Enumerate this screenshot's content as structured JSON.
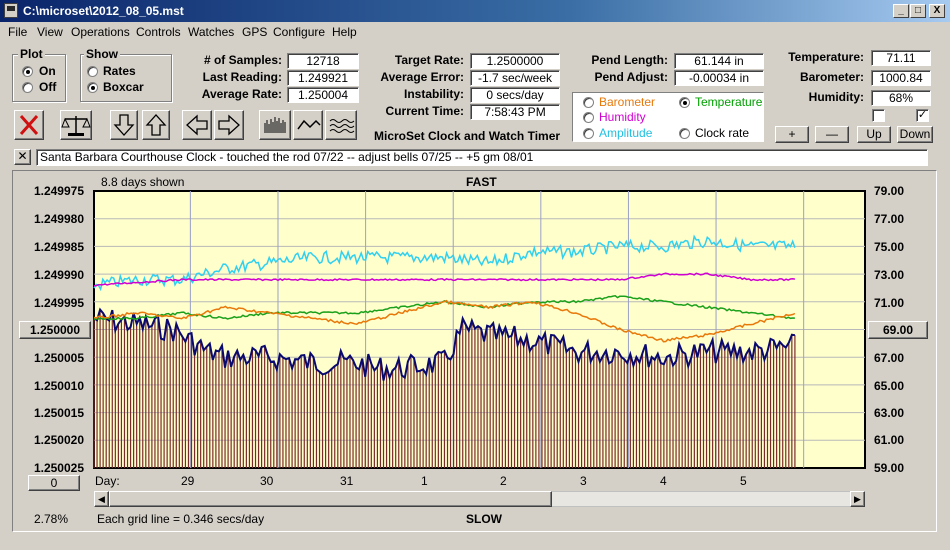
{
  "window": {
    "title": "C:\\microset\\2012_08_05.mst",
    "controls": [
      "_",
      "□",
      "X"
    ]
  },
  "menu": [
    "File",
    "View",
    "Operations",
    "Controls",
    "Watches",
    "GPS",
    "Configure",
    "Help"
  ],
  "plot_group": {
    "title": "Plot",
    "options": [
      "On",
      "Off"
    ],
    "selected": "On"
  },
  "show_group": {
    "title": "Show",
    "options": [
      "Rates",
      "Boxcar"
    ],
    "selected": "Boxcar"
  },
  "stats": {
    "samples_label": "# of Samples:",
    "samples": "12718",
    "last_label": "Last Reading:",
    "last": "1.249921",
    "avg_label": "Average Rate:",
    "avg": "1.250004",
    "target_label": "Target Rate:",
    "target": "1.2500000",
    "avgerr_label": "Average Error:",
    "avgerr": "-1.7 sec/week",
    "instab_label": "Instability:",
    "instab": "0 secs/day",
    "time_label": "Current Time:",
    "time": "7:58:43 PM",
    "pendlen_label": "Pend Length:",
    "pendlen": "61.144 in",
    "pendadj_label": "Pend Adjust:",
    "pendadj": "-0.00034 in",
    "temp_label": "Temperature:",
    "temp": "71.11",
    "baro_label": "Barometer:",
    "baro": "1000.84",
    "hum_label": "Humidity:",
    "hum": "68%"
  },
  "app_title": "MicroSet Clock and Watch Timer",
  "sensor_options": {
    "items": [
      {
        "label": "Barometer",
        "color": "#e8780a",
        "selected": false
      },
      {
        "label": "Temperature",
        "color": "#00a000",
        "selected": true
      },
      {
        "label": "Humidity",
        "color": "#d000d0",
        "selected": false
      },
      {
        "label": "Amplitude",
        "color": "#20c0e0",
        "selected": false
      },
      {
        "label": "Clock rate",
        "color": "#000000",
        "selected": false
      }
    ]
  },
  "scale_buttons": [
    "+",
    "—",
    "Up",
    "Down"
  ],
  "checkboxes": [
    false,
    true
  ],
  "toolbar_icons": [
    "close-x-icon",
    "scale-balance-icon",
    "arrow-down-icon",
    "arrow-up-icon",
    "arrow-left-icon",
    "arrow-right-icon",
    "bar-graph-icon",
    "line-graph-icon",
    "wave-graph-icon"
  ],
  "notes": "Santa Barbara Courthouse Clock  -  touched the rod 07/22  --  adjust bells 07/25  --  +5 gm 08/01",
  "graph": {
    "days_shown": "8.8 days shown",
    "top_label": "FAST",
    "bottom_label": "SLOW",
    "left_ticks": [
      "1.249975",
      "1.249980",
      "1.249985",
      "1.249990",
      "1.249995",
      "1.250000",
      "1.250005",
      "1.250010",
      "1.250015",
      "1.250020",
      "1.250025"
    ],
    "left_center_button": "1.250000",
    "left_bottom_button": "0",
    "right_ticks": [
      "79.00",
      "77.00",
      "75.00",
      "73.00",
      "71.00",
      "69.00",
      "67.00",
      "65.00",
      "63.00",
      "61.00",
      "59.00"
    ],
    "right_center_button": "69.00",
    "day_label": "Day:",
    "day_ticks": [
      "29",
      "30",
      "31",
      "1",
      "2",
      "3",
      "4",
      "5"
    ],
    "percent": "2.78%",
    "grid_note": "Each grid line = 0.346 secs/day"
  },
  "chart_data": {
    "type": "line",
    "title": "",
    "xlabel": "Day:",
    "x_ticks": [
      "29",
      "30",
      "31",
      "1",
      "2",
      "3",
      "4",
      "5"
    ],
    "y_left": {
      "label": "",
      "range": [
        1.250025,
        1.249975
      ],
      "ticks": [
        "1.249975",
        "1.249980",
        "1.249985",
        "1.249990",
        "1.249995",
        "1.250000",
        "1.250005",
        "1.250010",
        "1.250015",
        "1.250020",
        "1.250025"
      ]
    },
    "y_right": {
      "label": "",
      "range": [
        59.0,
        79.0
      ],
      "ticks": [
        "59.00",
        "61.00",
        "63.00",
        "65.00",
        "67.00",
        "69.00",
        "71.00",
        "73.00",
        "75.00",
        "77.00",
        "79.00"
      ]
    },
    "x_range_days": [
      0,
      8.8
    ],
    "day_tick_positions": [
      1.1,
      2.1,
      3.1,
      4.1,
      5.1,
      6.1,
      7.1,
      8.1
    ],
    "series": [
      {
        "name": "Clock rate",
        "color": "#0a0a6e",
        "axis": "left",
        "x": [
          0,
          0.5,
          0.9,
          1.3,
          1.5,
          2.0,
          2.5,
          3.0,
          3.2,
          3.5,
          4.0,
          4.2,
          4.5,
          5.0,
          5.5,
          6.0,
          6.5,
          7.0,
          7.5,
          8.0,
          8.8
        ],
        "y": [
          1.249998,
          1.249999,
          1.25,
          1.250004,
          1.250005,
          1.250005,
          1.250006,
          1.250006,
          1.250007,
          1.250007,
          1.250006,
          1.25,
          1.250001,
          1.250002,
          1.250004,
          1.250004,
          1.250005,
          1.250004,
          1.250004,
          1.250003,
          1.250002
        ]
      },
      {
        "name": "Amplitude",
        "color": "#30d0f0",
        "axis": "left",
        "x": [
          0,
          0.5,
          1.0,
          1.5,
          2.0,
          2.5,
          3.0,
          3.5,
          4.0,
          4.5,
          5.0,
          5.5,
          6.0,
          6.5,
          7.0,
          7.5,
          8.0,
          8.8
        ],
        "y": [
          1.249992,
          1.249991,
          1.249991,
          1.249989,
          1.249988,
          1.249987,
          1.249987,
          1.249987,
          1.249987,
          1.249988,
          1.249986,
          1.249986,
          1.249985,
          1.249985,
          1.249984,
          1.249985,
          1.249985,
          1.249985
        ]
      },
      {
        "name": "Humidity",
        "color": "#d000d0",
        "axis": "left",
        "x": [
          0,
          1.0,
          2.0,
          3.0,
          4.0,
          5.0,
          6.0,
          6.5,
          7.0,
          7.5,
          8.0,
          8.8
        ],
        "y": [
          1.249992,
          1.249991,
          1.249991,
          1.249991,
          1.249991,
          1.249991,
          1.249991,
          1.24999,
          1.24999,
          1.249991,
          1.249991,
          1.24999
        ]
      },
      {
        "name": "Temperature",
        "color": "#1aa01a",
        "axis": "left",
        "x": [
          0,
          0.5,
          1.0,
          1.5,
          2.0,
          2.5,
          3.0,
          3.5,
          4.0,
          4.5,
          5.0,
          5.5,
          6.0,
          6.5,
          7.0,
          7.5,
          8.0,
          8.5,
          8.8
        ],
        "y": [
          1.249998,
          1.249998,
          1.249997,
          1.249998,
          1.249997,
          1.249997,
          1.249997,
          1.249996,
          1.249995,
          1.249996,
          1.249995,
          1.249995,
          1.249994,
          1.249995,
          1.249996,
          1.249997,
          1.249998,
          1.249997,
          1.249995
        ]
      },
      {
        "name": "Barometer",
        "color": "#e8780a",
        "axis": "left",
        "x": [
          0,
          0.5,
          1.0,
          1.5,
          2.0,
          2.5,
          3.0,
          3.5,
          4.0,
          4.5,
          5.0,
          5.5,
          6.0,
          6.5,
          7.0,
          7.5,
          8.0,
          8.5,
          8.8
        ],
        "y": [
          1.249998,
          1.249997,
          1.249998,
          1.249996,
          1.249997,
          1.249998,
          1.249999,
          1.249997,
          1.249995,
          1.249996,
          1.249995,
          1.249997,
          1.25,
          1.250002,
          1.250001,
          1.249999,
          1.249997,
          1.249996,
          1.249999
        ]
      }
    ],
    "grid": true
  }
}
